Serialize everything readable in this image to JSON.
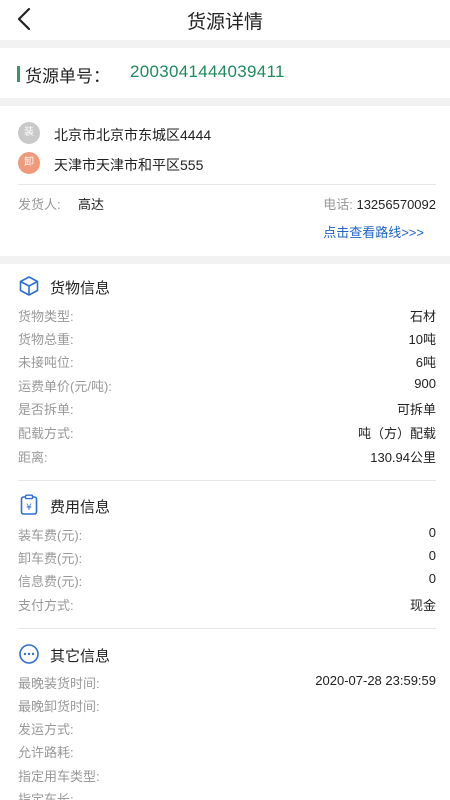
{
  "header": {
    "title": "货源详情"
  },
  "order": {
    "label": "货源单号：",
    "number": "2003041444039411"
  },
  "route": {
    "load_tag": "装",
    "load_address": "北京市北京市东城区4444",
    "unload_tag": "卸",
    "unload_address": "天津市天津市和平区555",
    "shipper_label": "发货人:",
    "shipper_name": "高达",
    "phone_label": "电话:",
    "phone": "13256570092",
    "route_link": "点击查看路线>>>"
  },
  "cargo": {
    "title": "货物信息",
    "rows": [
      {
        "label": "货物类型:",
        "value": "石材"
      },
      {
        "label": "货物总重:",
        "value": "10吨"
      },
      {
        "label": "未接吨位:",
        "value": "6吨"
      },
      {
        "label": "运费单价(元/吨):",
        "value": "900"
      },
      {
        "label": "是否拆单:",
        "value": "可拆单"
      },
      {
        "label": "配载方式:",
        "value": "吨（方）配载"
      },
      {
        "label": "距离:",
        "value": "130.94公里"
      }
    ]
  },
  "fee": {
    "title": "费用信息",
    "icon_glyph": "¥",
    "rows": [
      {
        "label": "装车费(元):",
        "value": "0"
      },
      {
        "label": "卸车费(元):",
        "value": "0"
      },
      {
        "label": "信息费(元):",
        "value": "0"
      },
      {
        "label": "支付方式:",
        "value": "现金"
      }
    ]
  },
  "other": {
    "title": "其它信息",
    "rows": [
      {
        "label": "最晚装货时间:",
        "value": "2020-07-28 23:59:59"
      },
      {
        "label": "最晚卸货时间:",
        "value": ""
      },
      {
        "label": "发运方式:",
        "value": ""
      },
      {
        "label": "允许路耗:",
        "value": ""
      },
      {
        "label": "指定用车类型:",
        "value": ""
      },
      {
        "label": "指定车长:",
        "value": ""
      }
    ]
  },
  "colors": {
    "accent_green": "#1f8a5d",
    "link_blue": "#1f63c7",
    "icon_blue": "#2f6fd0"
  },
  "icons": {
    "back": "chevron-left-icon",
    "cargo": "box-icon",
    "fee": "receipt-icon",
    "other": "more-dots-icon"
  }
}
